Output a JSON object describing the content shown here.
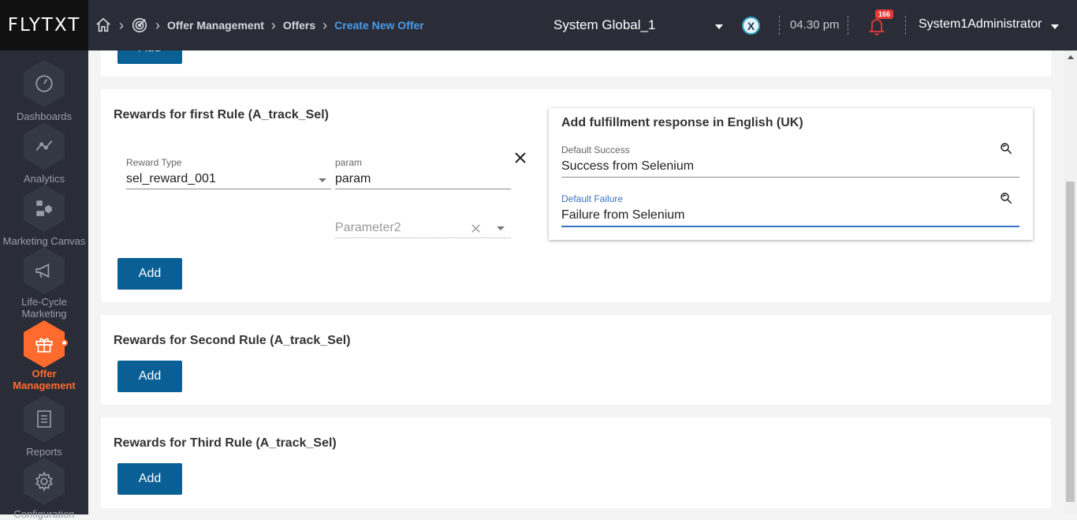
{
  "header": {
    "logo": "FLYTXT",
    "breadcrumb": [
      "Offer Management",
      "Offers",
      "Create New Offer"
    ],
    "tenant": "System Global_1",
    "time": "04.30 pm",
    "notification_count": "166",
    "user": "System1Administrator"
  },
  "sidebar": {
    "items": [
      {
        "label": "Dashboards",
        "icon": "gauge-icon"
      },
      {
        "label": "Analytics",
        "icon": "line-chart-icon"
      },
      {
        "label": "Marketing Canvas",
        "icon": "workflow-icon"
      },
      {
        "label": "Life-Cycle Marketing",
        "icon": "megaphone-icon"
      },
      {
        "label": "Offer Management",
        "icon": "gift-icon",
        "active": true
      },
      {
        "label": "Reports",
        "icon": "document-icon"
      },
      {
        "label": "Configuration",
        "icon": "gear-icon"
      }
    ]
  },
  "top_card": {
    "add_label": "Add"
  },
  "rule1": {
    "title": "Rewards for first Rule (A_track_Sel)",
    "reward_type_label": "Reward Type",
    "reward_type_value": "sel_reward_001",
    "param_label": "param",
    "param_value": "param",
    "param2_placeholder": "Parameter2",
    "add_label": "Add",
    "fulfillment": {
      "title": "Add fulfillment response in English (UK)",
      "success_label": "Default Success",
      "success_value": "Success from Selenium",
      "failure_label": "Default Failure",
      "failure_value": "Failure from Selenium"
    }
  },
  "rule2": {
    "title": "Rewards for Second Rule (A_track_Sel)",
    "add_label": "Add"
  },
  "rule3": {
    "title": "Rewards for Third Rule (A_track_Sel)",
    "add_label": "Add"
  }
}
